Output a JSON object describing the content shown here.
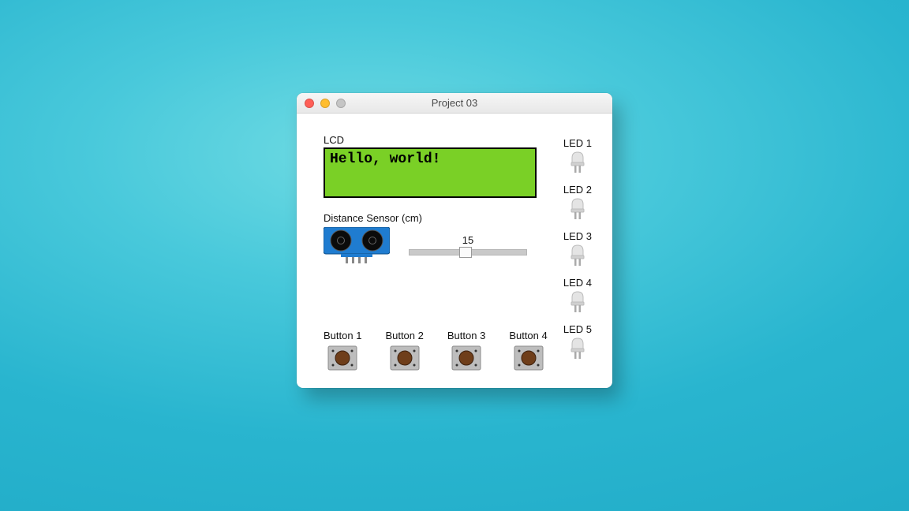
{
  "window": {
    "title": "Project 03"
  },
  "lcd": {
    "label": "LCD",
    "text": "Hello, world!"
  },
  "distance": {
    "label": "Distance Sensor (cm)",
    "value": "15"
  },
  "buttons": [
    {
      "label": "Button 1"
    },
    {
      "label": "Button 2"
    },
    {
      "label": "Button 3"
    },
    {
      "label": "Button 4"
    }
  ],
  "leds": [
    {
      "label": "LED 1"
    },
    {
      "label": "LED 2"
    },
    {
      "label": "LED 3"
    },
    {
      "label": "LED 4"
    },
    {
      "label": "LED 5"
    }
  ]
}
